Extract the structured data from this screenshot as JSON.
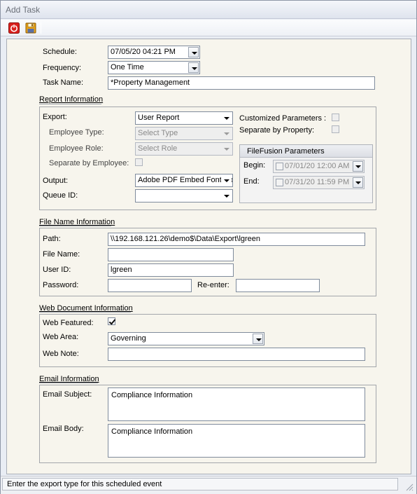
{
  "window": {
    "title": "Add Task"
  },
  "toolbar": {
    "close_icon": "power-close-icon",
    "save_icon": "floppy-save-icon"
  },
  "schedule": {
    "schedule_label": "Schedule:",
    "schedule_value": "07/05/20 04:21 PM",
    "frequency_label": "Frequency:",
    "frequency_value": "One Time",
    "task_name_label": "Task Name:",
    "task_name_value": "*Property Management"
  },
  "report": {
    "title": "Report Information",
    "export_label": "Export:",
    "export_value": "User Report",
    "employee_type_label": "Employee Type:",
    "employee_type_value": "Select Type",
    "employee_role_label": "Employee Role:",
    "employee_role_value": "Select Role",
    "separate_by_employee_label": "Separate by Employee:",
    "output_label": "Output:",
    "output_value": "Adobe PDF Embed Font|*.pdf",
    "queue_id_label": "Queue ID:",
    "queue_id_value": "",
    "customized_parameters_label": "Customized Parameters :",
    "separate_by_property_label": "Separate by Property:",
    "filefusion": {
      "title": "FileFusion Parameters",
      "begin_label": "Begin:",
      "begin_value": "07/01/20 12:00 AM",
      "end_label": "End:",
      "end_value": "07/31/20 11:59 PM"
    }
  },
  "file_name": {
    "title": "File Name Information",
    "path_label": "Path:",
    "path_value": "\\\\192.168.121.26\\demo$\\Data\\Export\\lgreen",
    "file_name_label": "File Name:",
    "file_name_value": "",
    "user_id_label": "User ID:",
    "user_id_value": "lgreen",
    "password_label": "Password:",
    "password_value": "",
    "reenter_label": "Re-enter:",
    "reenter_value": ""
  },
  "web": {
    "title": "Web Document Information",
    "featured_label": "Web Featured:",
    "featured_checked": true,
    "area_label": "Web Area:",
    "area_value": "Governing",
    "note_label": "Web Note:",
    "note_value": ""
  },
  "email": {
    "title": "Email  Information",
    "subject_label": "Email Subject:",
    "subject_value": "Compliance Information",
    "body_label": "Email Body:",
    "body_value": "Compliance Information"
  },
  "status": {
    "text": "Enter the export type for this scheduled event"
  }
}
